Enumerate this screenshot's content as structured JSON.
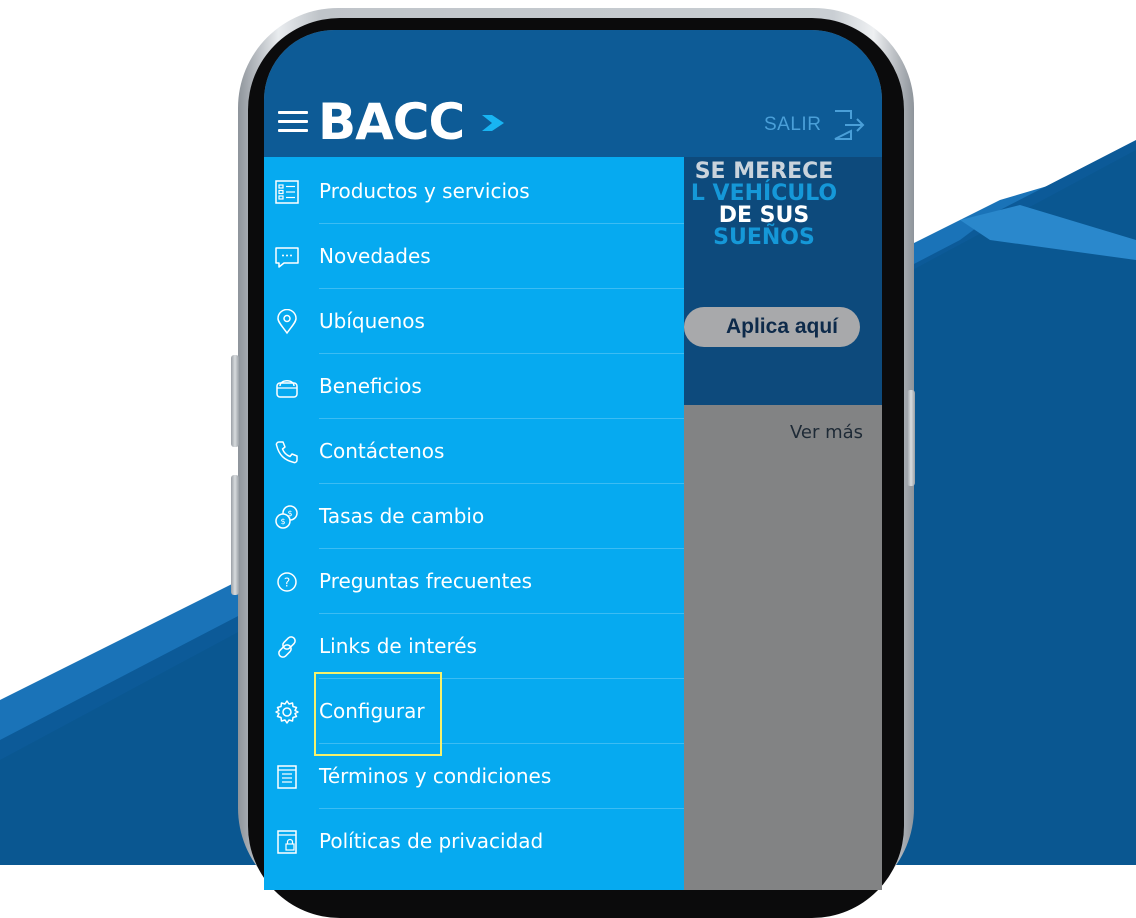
{
  "header": {
    "logo_text": "BACC",
    "logout_label": "SALIR"
  },
  "banner": {
    "lines": [
      "SE MERECE",
      "L VEHÍCULO",
      "DE SUS",
      "SUEÑOS"
    ],
    "apply_label": "Aplica aquí",
    "more_label": "Ver más"
  },
  "menu": {
    "items": [
      {
        "label": "Productos y servicios",
        "icon": "list-icon"
      },
      {
        "label": "Novedades",
        "icon": "chat-icon"
      },
      {
        "label": "Ubíquenos",
        "icon": "location-pin-icon"
      },
      {
        "label": "Beneficios",
        "icon": "bag-icon"
      },
      {
        "label": "Contáctenos",
        "icon": "phone-icon"
      },
      {
        "label": "Tasas de cambio",
        "icon": "currency-exchange-icon"
      },
      {
        "label": "Preguntas frecuentes",
        "icon": "help-icon"
      },
      {
        "label": "Links de interés",
        "icon": "link-icon"
      },
      {
        "label": "Configurar",
        "icon": "gear-icon"
      },
      {
        "label": "Términos y condiciones",
        "icon": "document-icon"
      },
      {
        "label": "Políticas de privacidad",
        "icon": "privacy-lock-icon"
      }
    ],
    "highlighted": "Configurar"
  },
  "colors": {
    "header_bg": "#0d5b96",
    "drawer_bg": "#06aaf0",
    "banner_bg": "#0d4a7c",
    "highlight_border": "#f4f16b",
    "page_accent": "#0a5791"
  }
}
